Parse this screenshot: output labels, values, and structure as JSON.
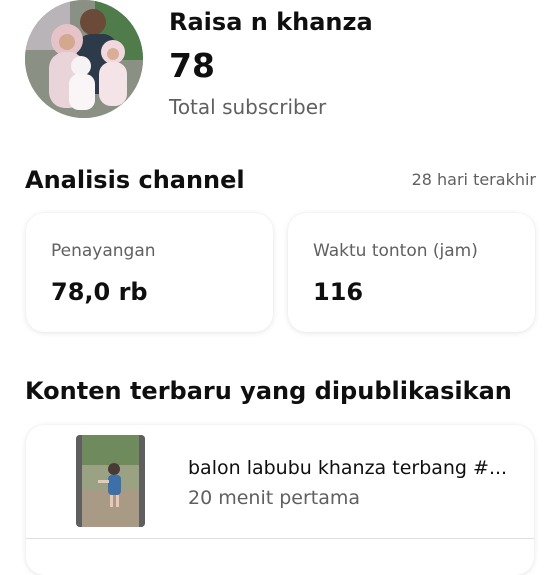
{
  "channel": {
    "name": "Raisa n khanza",
    "subscriber_count": "78",
    "subscriber_label": "Total subscriber"
  },
  "analytics": {
    "title": "Analisis channel",
    "period": "28 hari terakhir",
    "stats": [
      {
        "label": "Penayangan",
        "value": "78,0 rb"
      },
      {
        "label": "Waktu tonton (jam)",
        "value": "116"
      }
    ]
  },
  "latest_content": {
    "title": "Konten terbaru yang dipublikasikan",
    "items": [
      {
        "title": "balon labubu khanza terbang #...",
        "meta": "20 menit pertama"
      }
    ]
  },
  "colors": {
    "text_primary": "#0f0f0f",
    "text_secondary": "#606060",
    "background": "#ffffff"
  }
}
